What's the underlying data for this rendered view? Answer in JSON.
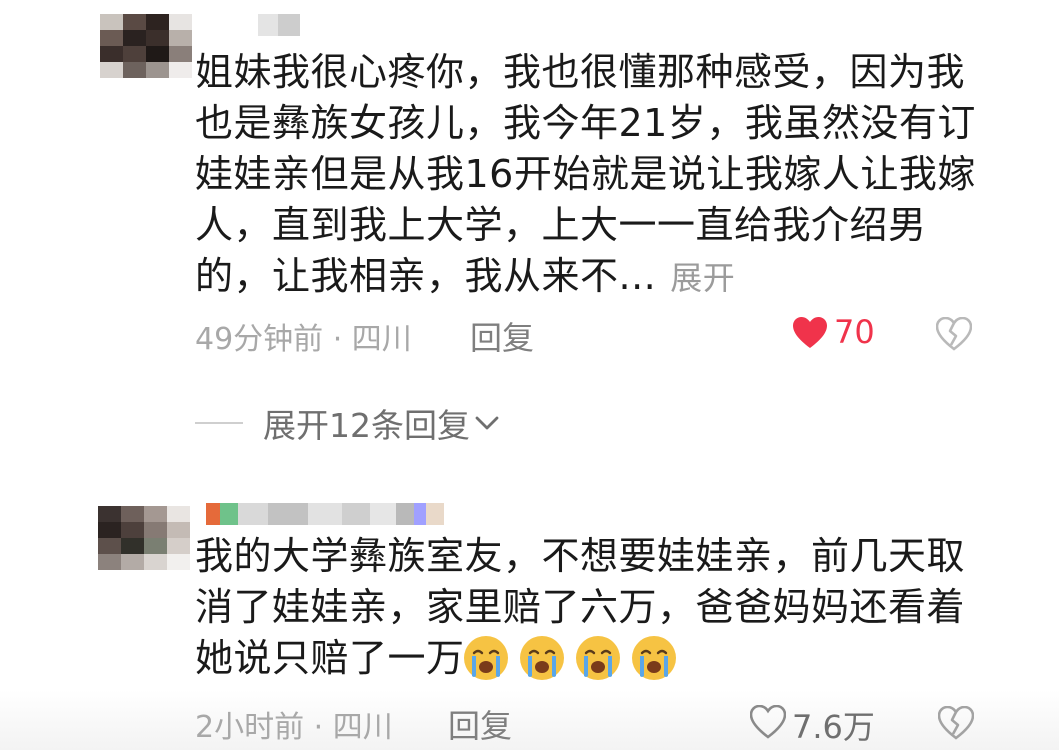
{
  "comments": [
    {
      "lines": [
        "姐妹我很心疼你，我也很懂那种感受，因为我",
        "也是彝族女孩儿，我今年21岁，我虽然没有订",
        "娃娃亲但是从我16开始就是说让我嫁人让我嫁",
        "人，直到我上大学，上大一一直给我介绍男",
        "的，让我相亲，我从来不..."
      ],
      "expand_label": "展开",
      "meta": "49分钟前 · 四川",
      "reply_label": "回复",
      "like_count": "70",
      "liked": true,
      "avatar_icon": "blurred-avatar",
      "like_icon": "heart-filled-icon",
      "dislike_icon": "broken-heart-icon"
    },
    {
      "lines": [
        "我的大学彝族室友，不想要娃娃亲，前几天取",
        "消了娃娃亲，家里赔了六万，爸爸妈妈还看着",
        "她说只赔了一万"
      ],
      "emojis": [
        "crying-face-icon",
        "crying-face-icon",
        "crying-face-icon",
        "crying-face-icon"
      ],
      "meta": "2小时前 · 四川",
      "reply_label": "回复",
      "like_count": "7.6万",
      "liked": false,
      "avatar_icon": "blurred-avatar",
      "like_icon": "heart-outline-icon",
      "dislike_icon": "broken-heart-icon"
    }
  ],
  "expand_replies_label": "展开12条回复",
  "colors": {
    "like_red": "#f0334b",
    "text": "#1a1a1a",
    "meta": "#a8a8a8",
    "emoji_yellow": "#f6c343",
    "tear_blue": "#5aa6e8"
  }
}
